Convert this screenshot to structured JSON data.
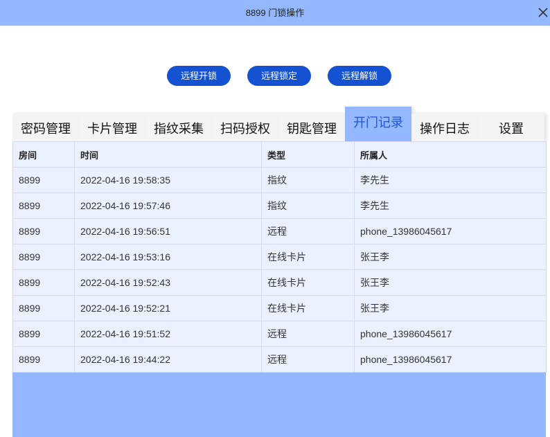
{
  "window": {
    "title": "8899 门锁操作",
    "close_icon": "close-icon"
  },
  "actions": {
    "remote_open": "远程开锁",
    "remote_lock": "远程锁定",
    "remote_unlock": "远程解锁"
  },
  "tabs": [
    {
      "label": "密码管理"
    },
    {
      "label": "卡片管理"
    },
    {
      "label": "指纹采集"
    },
    {
      "label": "扫码授权"
    },
    {
      "label": "钥匙管理"
    },
    {
      "label": "开门记录",
      "active": true
    },
    {
      "label": "操作日志"
    },
    {
      "label": "设置"
    }
  ],
  "table": {
    "headers": [
      "房间",
      "时间",
      "类型",
      "所属人"
    ],
    "rows": [
      [
        "8899",
        "2022-04-16 19:58:35",
        "指纹",
        "李先生"
      ],
      [
        "8899",
        "2022-04-16 19:57:46",
        "指纹",
        "李先生"
      ],
      [
        "8899",
        "2022-04-16 19:56:51",
        "远程",
        "phone_13986045617"
      ],
      [
        "8899",
        "2022-04-16 19:53:16",
        "在线卡片",
        "张王李"
      ],
      [
        "8899",
        "2022-04-16 19:52:43",
        "在线卡片",
        "张王李"
      ],
      [
        "8899",
        "2022-04-16 19:52:21",
        "在线卡片",
        "张王李"
      ],
      [
        "8899",
        "2022-04-16 19:51:52",
        "远程",
        "phone_13986045617"
      ],
      [
        "8899",
        "2022-04-16 19:44:22",
        "远程",
        "phone_13986045617"
      ]
    ]
  },
  "colors": {
    "titlebar": "#93b8ff",
    "button": "#1452d1",
    "active_tab_text": "#1f55d6",
    "table_row": "#eaf0fd"
  }
}
